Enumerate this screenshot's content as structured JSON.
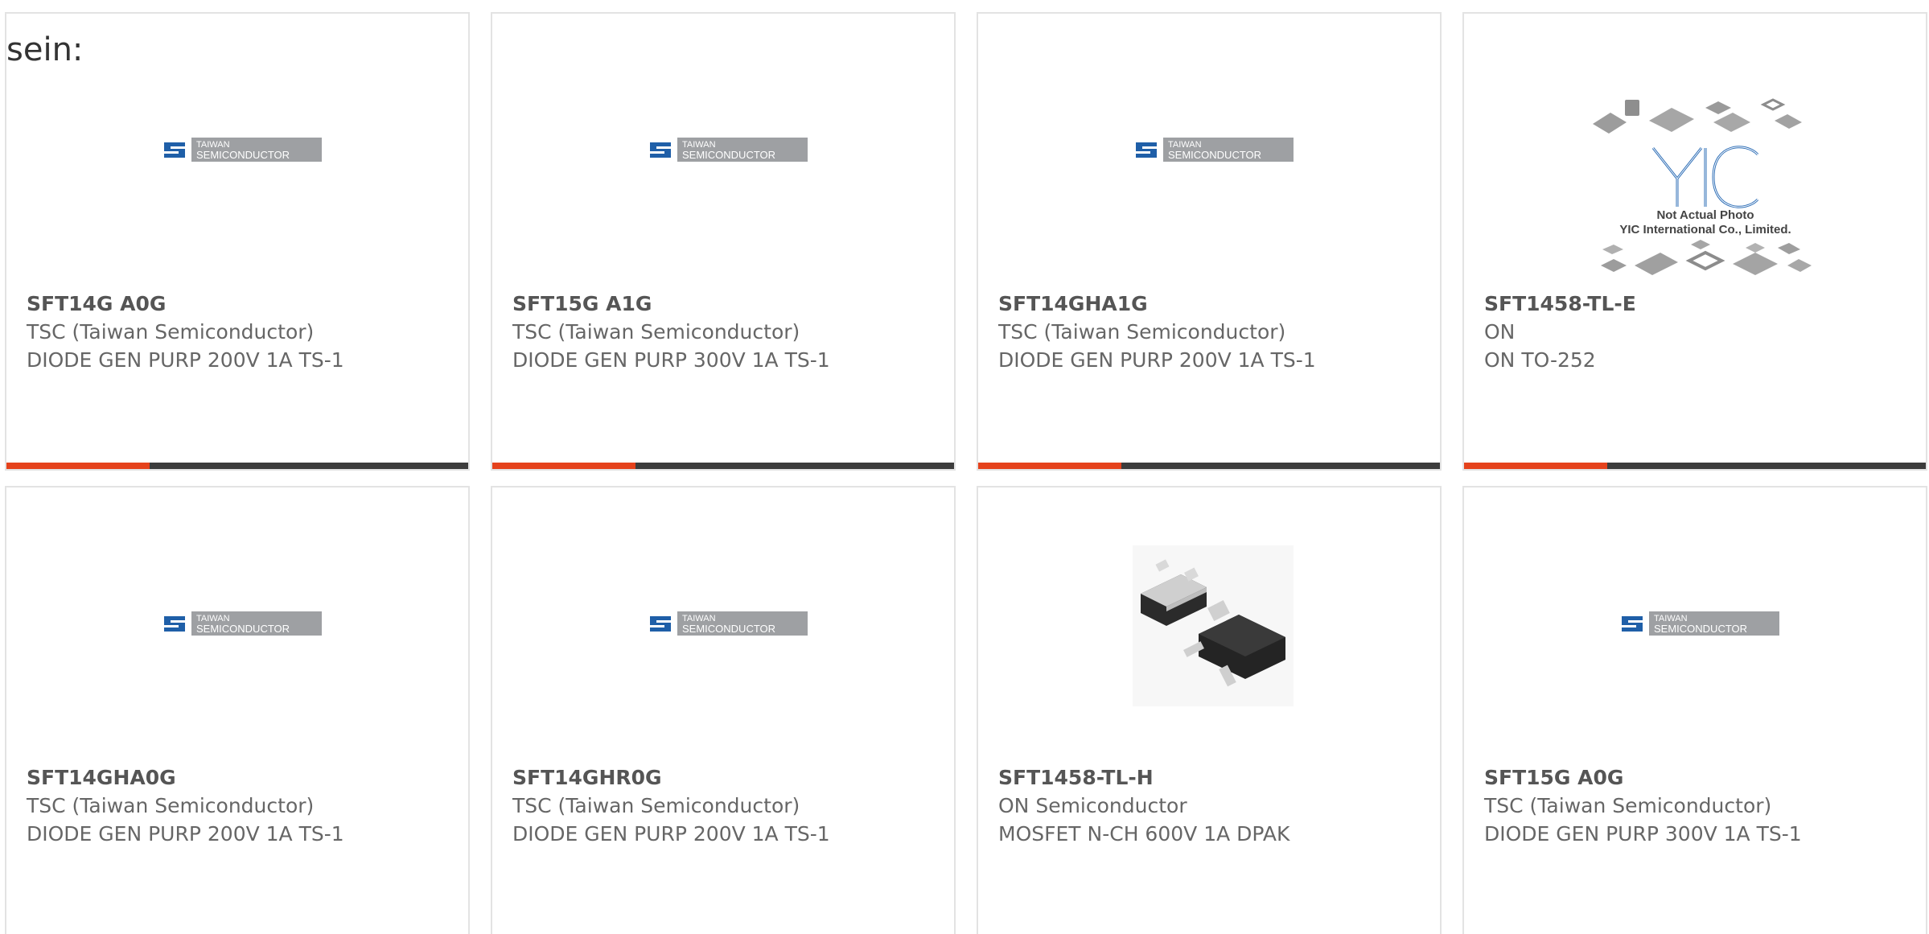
{
  "header": {
    "text": "sein:"
  },
  "logo": {
    "tsc_line1": "TAIWAN",
    "tsc_line2": "SEMICONDUCTOR",
    "yic_line1": "Not Actual Photo",
    "yic_line2": "YIC International Co., Limited."
  },
  "products": [
    {
      "part_number": "SFT14G A0G",
      "manufacturer": "TSC (Taiwan Semiconductor)",
      "description": "DIODE GEN PURP 200V 1A TS-1",
      "image": "taiwan-semiconductor-logo",
      "progress": 0.31
    },
    {
      "part_number": "SFT15G A1G",
      "manufacturer": "TSC (Taiwan Semiconductor)",
      "description": "DIODE GEN PURP 300V 1A TS-1",
      "image": "taiwan-semiconductor-logo",
      "progress": 0.31
    },
    {
      "part_number": "SFT14GHA1G",
      "manufacturer": "TSC (Taiwan Semiconductor)",
      "description": "DIODE GEN PURP 200V 1A TS-1",
      "image": "taiwan-semiconductor-logo",
      "progress": 0.31
    },
    {
      "part_number": "SFT1458-TL-E",
      "manufacturer": "ON",
      "description": "ON TO-252",
      "image": "yic-placeholder-photo",
      "progress": 0.31
    },
    {
      "part_number": "SFT14GHA0G",
      "manufacturer": "TSC (Taiwan Semiconductor)",
      "description": "DIODE GEN PURP 200V 1A TS-1",
      "image": "taiwan-semiconductor-logo"
    },
    {
      "part_number": "SFT14GHR0G",
      "manufacturer": "TSC (Taiwan Semiconductor)",
      "description": "DIODE GEN PURP 200V 1A TS-1",
      "image": "taiwan-semiconductor-logo"
    },
    {
      "part_number": "SFT1458-TL-H",
      "manufacturer": "ON Semiconductor",
      "description": "MOSFET N-CH 600V 1A DPAK",
      "image": "dpak-package-photo"
    },
    {
      "part_number": "SFT15G A0G",
      "manufacturer": "TSC (Taiwan Semiconductor)",
      "description": "DIODE GEN PURP 300V 1A TS-1",
      "image": "taiwan-semiconductor-logo"
    }
  ],
  "colors": {
    "progress_fill": "#e5421c",
    "progress_track": "#3c3c3c",
    "card_border": "#e3e3e3",
    "logo_blue": "#1f5fa8",
    "logo_gray": "#9ea0a3"
  }
}
